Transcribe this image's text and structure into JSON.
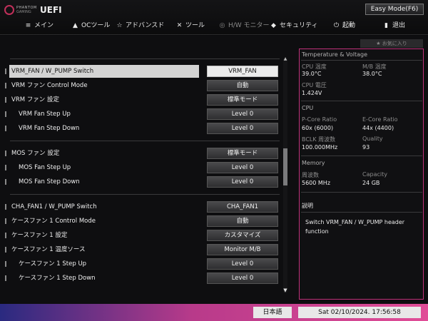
{
  "header": {
    "brand_line1": "PHANTOM",
    "brand_line2": "GAMING",
    "uefi": "UEFI",
    "easy_mode": "Easy Mode(F6)"
  },
  "nav": [
    {
      "icon": "≡",
      "icon_name": "menu-icon",
      "label": "メイン"
    },
    {
      "icon": "▲",
      "icon_name": "rocket-icon",
      "label": "OCツール"
    },
    {
      "icon": "☆",
      "icon_name": "star-icon",
      "label": "アドバンスド"
    },
    {
      "icon": "✕",
      "icon_name": "tools-icon",
      "label": "ツール"
    },
    {
      "icon": "◎",
      "icon_name": "monitor-gauge-icon",
      "label": "H/W モニター"
    },
    {
      "icon": "◆",
      "icon_name": "shield-icon",
      "label": "セキュリティ"
    },
    {
      "icon": "⏻",
      "icon_name": "power-icon",
      "label": "起動"
    },
    {
      "icon": "▮",
      "icon_name": "exit-icon",
      "label": "退出"
    }
  ],
  "rows": [
    {
      "label": "VRM_FAN / W_PUMP Switch",
      "value": "VRM_FAN"
    },
    {
      "label": "VRM ファン Control Mode",
      "value": "自動"
    },
    {
      "label": "VRM ファン 設定",
      "value": "標準モード"
    },
    {
      "label": "VRM Fan Step Up",
      "value": "Level 0"
    },
    {
      "label": "VRM Fan Step Down",
      "value": "Level 0"
    },
    {
      "label": "MOS ファン 設定",
      "value": "標準モード"
    },
    {
      "label": "MOS Fan Step Up",
      "value": "Level 0"
    },
    {
      "label": "MOS Fan Step Down",
      "value": "Level 0"
    },
    {
      "label": "CHA_FAN1 / W_PUMP Switch",
      "value": "CHA_FAN1"
    },
    {
      "label": "ケースファン 1 Control Mode",
      "value": "自動"
    },
    {
      "label": "ケースファン 1 設定",
      "value": "カスタマイズ"
    },
    {
      "label": "ケースファン 1 温度ソース",
      "value": "Monitor M/B"
    },
    {
      "label": "ケースファン 1 Step Up",
      "value": "Level 0"
    },
    {
      "label": "ケースファン 1 Step Down",
      "value": "Level 0"
    }
  ],
  "favorites": "★ お気に入り",
  "info": {
    "title": "Temperature & Voltage",
    "cpu_temp_label": "CPU 温度",
    "cpu_temp": "39.0°C",
    "mb_temp_label": "M/B 温度",
    "mb_temp": "38.0°C",
    "cpu_volt_label": "CPU 電圧",
    "cpu_volt": "1.424V",
    "cpu_section": "CPU",
    "pcore_label": "P-Core Ratio",
    "pcore": "60x (6000)",
    "ecore_label": "E-Core Ratio",
    "ecore": "44x (4400)",
    "bclk_label": "BCLK 周波数",
    "bclk": "100.000MHz",
    "quality_label": "Quality",
    "quality": "93",
    "memory_section": "Memory",
    "freq_label": "周波数",
    "freq": "5600 MHz",
    "capacity_label": "Capacity",
    "capacity": "24 GB",
    "desc_title": "説明",
    "desc_line1": "Switch VRM_FAN / W_PUMP header",
    "desc_line2": "function"
  },
  "footer": {
    "language": "日本語",
    "datetime": "Sat 02/10/2024. 17:56:58"
  },
  "colors": {
    "accent_border": "#c0307a",
    "bottom_gradient_start": "#2a2a80",
    "bottom_gradient_end": "#e04d97"
  }
}
